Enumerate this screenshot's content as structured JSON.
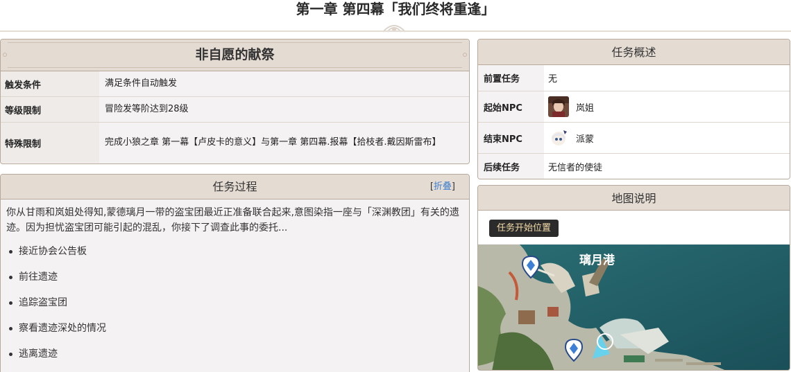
{
  "page": {
    "title": "第一章 第四幕「我们终将重逢」"
  },
  "task": {
    "heading": "非自愿的献祭",
    "rows": [
      {
        "key": "触发条件",
        "value": "满足条件自动触发"
      },
      {
        "key": "等级限制",
        "value": "冒险发等阶达到28级"
      },
      {
        "key": "特殊限制",
        "value": "完成小狼之章 第一幕【卢皮卡的意义】与第一章 第四幕.报幕【拾枝者.戴因斯雷布】"
      }
    ]
  },
  "process": {
    "heading": "任务过程",
    "fold_open": "[",
    "fold_label": "折叠",
    "fold_close": "]",
    "intro": "你从甘雨和岚姐处得知,蒙德璃月一带的盗宝团最近正准备联合起来,意图染指一座与「深渊教团」有关的遗迹。因为担忧盗宝团可能引起的混乱，你接下了调查此事的委托...",
    "steps": [
      "接近协会公告板",
      "前往遗迹",
      "追踪盗宝团",
      "察看遗迹深处的情况",
      "逃离遗迹"
    ]
  },
  "overview": {
    "heading": "任务概述",
    "rows": [
      {
        "key": "前置任务",
        "value": "无",
        "icon": ""
      },
      {
        "key": "起始NPC",
        "value": "岚姐",
        "icon": "npc-lanjie-avatar"
      },
      {
        "key": "结束NPC",
        "value": "派蒙",
        "icon": "npc-paimon-avatar"
      },
      {
        "key": "后续任务",
        "value": "无信者的使徒",
        "icon": ""
      }
    ]
  },
  "map": {
    "heading": "地图说明",
    "button": "任务开始位置",
    "location_label": "璃月港"
  }
}
